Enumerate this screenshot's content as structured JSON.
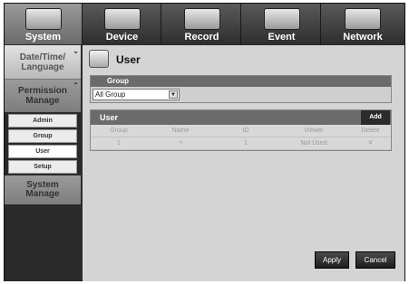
{
  "tabs": [
    {
      "label": "System",
      "icon": "system-icon"
    },
    {
      "label": "Device",
      "icon": "camera-icon"
    },
    {
      "label": "Record",
      "icon": "record-icon"
    },
    {
      "label": "Event",
      "icon": "event-icon"
    },
    {
      "label": "Network",
      "icon": "network-icon"
    }
  ],
  "sidebar": {
    "date_time_language": "Date/Time/\nLanguage",
    "permission_manage": "Permission\nManage",
    "items": [
      "Admin",
      "Group",
      "User",
      "Setup"
    ],
    "system_manage": "System\nManage"
  },
  "main": {
    "title": "User",
    "group_label": "Group",
    "group_value": "All Group",
    "user_label": "User",
    "add_label": "Add",
    "columns": [
      "Group",
      "Name",
      "ID",
      "Viewer",
      "Delete"
    ],
    "rows": [
      {
        "group": "1",
        "name": "ㄱ",
        "id": "1",
        "viewer": "Not Used",
        "delete": "✕"
      }
    ],
    "apply_label": "Apply",
    "cancel_label": "Cancel"
  }
}
